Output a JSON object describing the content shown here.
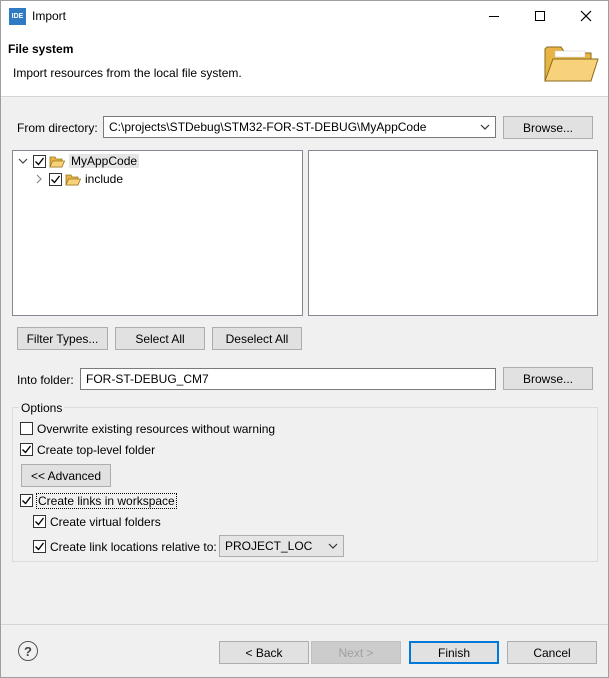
{
  "window": {
    "app_icon_text": "IDE",
    "title": "Import",
    "minimize": "minimize",
    "maximize": "maximize",
    "close": "close"
  },
  "header": {
    "title": "File system",
    "description": "Import resources from the local file system."
  },
  "from_directory": {
    "label": "From directory:",
    "value": "C:\\projects\\STDebug\\STM32-FOR-ST-DEBUG\\MyAppCode",
    "browse_label": "Browse..."
  },
  "tree": [
    {
      "label": "MyAppCode",
      "checked": true,
      "expanded": true,
      "selected": true
    },
    {
      "label": "include",
      "checked": true,
      "expanded": false,
      "selected": false
    }
  ],
  "selection_buttons": {
    "filter_types": "Filter Types...",
    "select_all": "Select All",
    "deselect_all": "Deselect All"
  },
  "into_folder": {
    "label": "Into folder:",
    "value": "FOR-ST-DEBUG_CM7",
    "browse_label": "Browse..."
  },
  "options": {
    "group_label": "Options",
    "overwrite": {
      "label": "Overwrite existing resources without warning",
      "checked": false
    },
    "create_top_level": {
      "label": "Create top-level folder",
      "checked": true
    },
    "advanced_label": "<< Advanced",
    "create_links": {
      "label": "Create links in workspace",
      "checked": true
    },
    "create_virtual": {
      "label": "Create virtual folders",
      "checked": true
    },
    "create_relative": {
      "label": "Create link locations relative to:",
      "checked": true
    },
    "relative_value": "PROJECT_LOC"
  },
  "footer": {
    "help_label": "?",
    "back": "< Back",
    "next": "Next >",
    "finish": "Finish",
    "cancel": "Cancel"
  },
  "colors": {
    "accent": "#0078d7",
    "folder": "#f3c35a",
    "app_icon": "#2e7bc4"
  }
}
